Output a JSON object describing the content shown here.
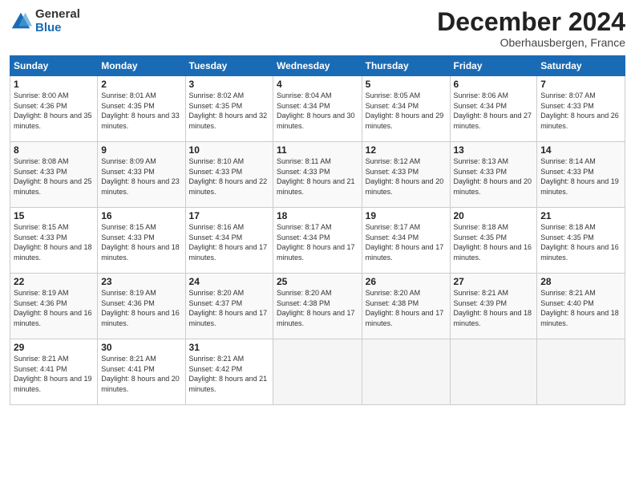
{
  "header": {
    "logo_general": "General",
    "logo_blue": "Blue",
    "month_title": "December 2024",
    "location": "Oberhausbergen, France"
  },
  "weekdays": [
    "Sunday",
    "Monday",
    "Tuesday",
    "Wednesday",
    "Thursday",
    "Friday",
    "Saturday"
  ],
  "weeks": [
    [
      {
        "day": "1",
        "sunrise": "8:00 AM",
        "sunset": "4:36 PM",
        "daylight": "8 hours and 35 minutes."
      },
      {
        "day": "2",
        "sunrise": "8:01 AM",
        "sunset": "4:35 PM",
        "daylight": "8 hours and 33 minutes."
      },
      {
        "day": "3",
        "sunrise": "8:02 AM",
        "sunset": "4:35 PM",
        "daylight": "8 hours and 32 minutes."
      },
      {
        "day": "4",
        "sunrise": "8:04 AM",
        "sunset": "4:34 PM",
        "daylight": "8 hours and 30 minutes."
      },
      {
        "day": "5",
        "sunrise": "8:05 AM",
        "sunset": "4:34 PM",
        "daylight": "8 hours and 29 minutes."
      },
      {
        "day": "6",
        "sunrise": "8:06 AM",
        "sunset": "4:34 PM",
        "daylight": "8 hours and 27 minutes."
      },
      {
        "day": "7",
        "sunrise": "8:07 AM",
        "sunset": "4:33 PM",
        "daylight": "8 hours and 26 minutes."
      }
    ],
    [
      {
        "day": "8",
        "sunrise": "8:08 AM",
        "sunset": "4:33 PM",
        "daylight": "8 hours and 25 minutes."
      },
      {
        "day": "9",
        "sunrise": "8:09 AM",
        "sunset": "4:33 PM",
        "daylight": "8 hours and 23 minutes."
      },
      {
        "day": "10",
        "sunrise": "8:10 AM",
        "sunset": "4:33 PM",
        "daylight": "8 hours and 22 minutes."
      },
      {
        "day": "11",
        "sunrise": "8:11 AM",
        "sunset": "4:33 PM",
        "daylight": "8 hours and 21 minutes."
      },
      {
        "day": "12",
        "sunrise": "8:12 AM",
        "sunset": "4:33 PM",
        "daylight": "8 hours and 20 minutes."
      },
      {
        "day": "13",
        "sunrise": "8:13 AM",
        "sunset": "4:33 PM",
        "daylight": "8 hours and 20 minutes."
      },
      {
        "day": "14",
        "sunrise": "8:14 AM",
        "sunset": "4:33 PM",
        "daylight": "8 hours and 19 minutes."
      }
    ],
    [
      {
        "day": "15",
        "sunrise": "8:15 AM",
        "sunset": "4:33 PM",
        "daylight": "8 hours and 18 minutes."
      },
      {
        "day": "16",
        "sunrise": "8:15 AM",
        "sunset": "4:33 PM",
        "daylight": "8 hours and 18 minutes."
      },
      {
        "day": "17",
        "sunrise": "8:16 AM",
        "sunset": "4:34 PM",
        "daylight": "8 hours and 17 minutes."
      },
      {
        "day": "18",
        "sunrise": "8:17 AM",
        "sunset": "4:34 PM",
        "daylight": "8 hours and 17 minutes."
      },
      {
        "day": "19",
        "sunrise": "8:17 AM",
        "sunset": "4:34 PM",
        "daylight": "8 hours and 17 minutes."
      },
      {
        "day": "20",
        "sunrise": "8:18 AM",
        "sunset": "4:35 PM",
        "daylight": "8 hours and 16 minutes."
      },
      {
        "day": "21",
        "sunrise": "8:18 AM",
        "sunset": "4:35 PM",
        "daylight": "8 hours and 16 minutes."
      }
    ],
    [
      {
        "day": "22",
        "sunrise": "8:19 AM",
        "sunset": "4:36 PM",
        "daylight": "8 hours and 16 minutes."
      },
      {
        "day": "23",
        "sunrise": "8:19 AM",
        "sunset": "4:36 PM",
        "daylight": "8 hours and 16 minutes."
      },
      {
        "day": "24",
        "sunrise": "8:20 AM",
        "sunset": "4:37 PM",
        "daylight": "8 hours and 17 minutes."
      },
      {
        "day": "25",
        "sunrise": "8:20 AM",
        "sunset": "4:38 PM",
        "daylight": "8 hours and 17 minutes."
      },
      {
        "day": "26",
        "sunrise": "8:20 AM",
        "sunset": "4:38 PM",
        "daylight": "8 hours and 17 minutes."
      },
      {
        "day": "27",
        "sunrise": "8:21 AM",
        "sunset": "4:39 PM",
        "daylight": "8 hours and 18 minutes."
      },
      {
        "day": "28",
        "sunrise": "8:21 AM",
        "sunset": "4:40 PM",
        "daylight": "8 hours and 18 minutes."
      }
    ],
    [
      {
        "day": "29",
        "sunrise": "8:21 AM",
        "sunset": "4:41 PM",
        "daylight": "8 hours and 19 minutes."
      },
      {
        "day": "30",
        "sunrise": "8:21 AM",
        "sunset": "4:41 PM",
        "daylight": "8 hours and 20 minutes."
      },
      {
        "day": "31",
        "sunrise": "8:21 AM",
        "sunset": "4:42 PM",
        "daylight": "8 hours and 21 minutes."
      },
      null,
      null,
      null,
      null
    ]
  ]
}
